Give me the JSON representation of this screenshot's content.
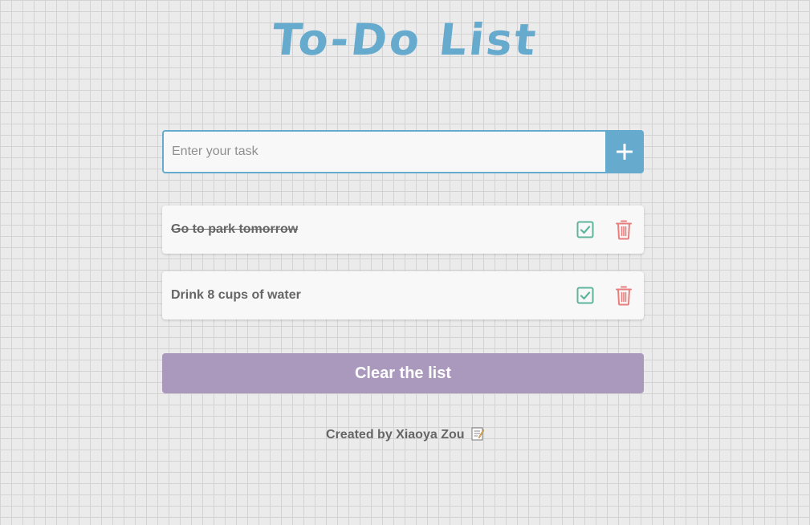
{
  "title": "To-Do List",
  "input": {
    "placeholder": "Enter your task",
    "value": ""
  },
  "add_button": {
    "icon": "plus-icon"
  },
  "tasks": [
    {
      "text": "Go to park tomorrow",
      "completed": true
    },
    {
      "text": "Drink 8 cups of water",
      "completed": false
    }
  ],
  "clear_button": {
    "label": "Clear the list"
  },
  "footer": {
    "text": "Created by Xiaoya Zou",
    "icon": "memo-icon"
  },
  "colors": {
    "accent": "#66abcd",
    "check": "#5fb59a",
    "delete": "#e97e7e",
    "clear": "#ab99bd",
    "background": "#ebebeb"
  }
}
